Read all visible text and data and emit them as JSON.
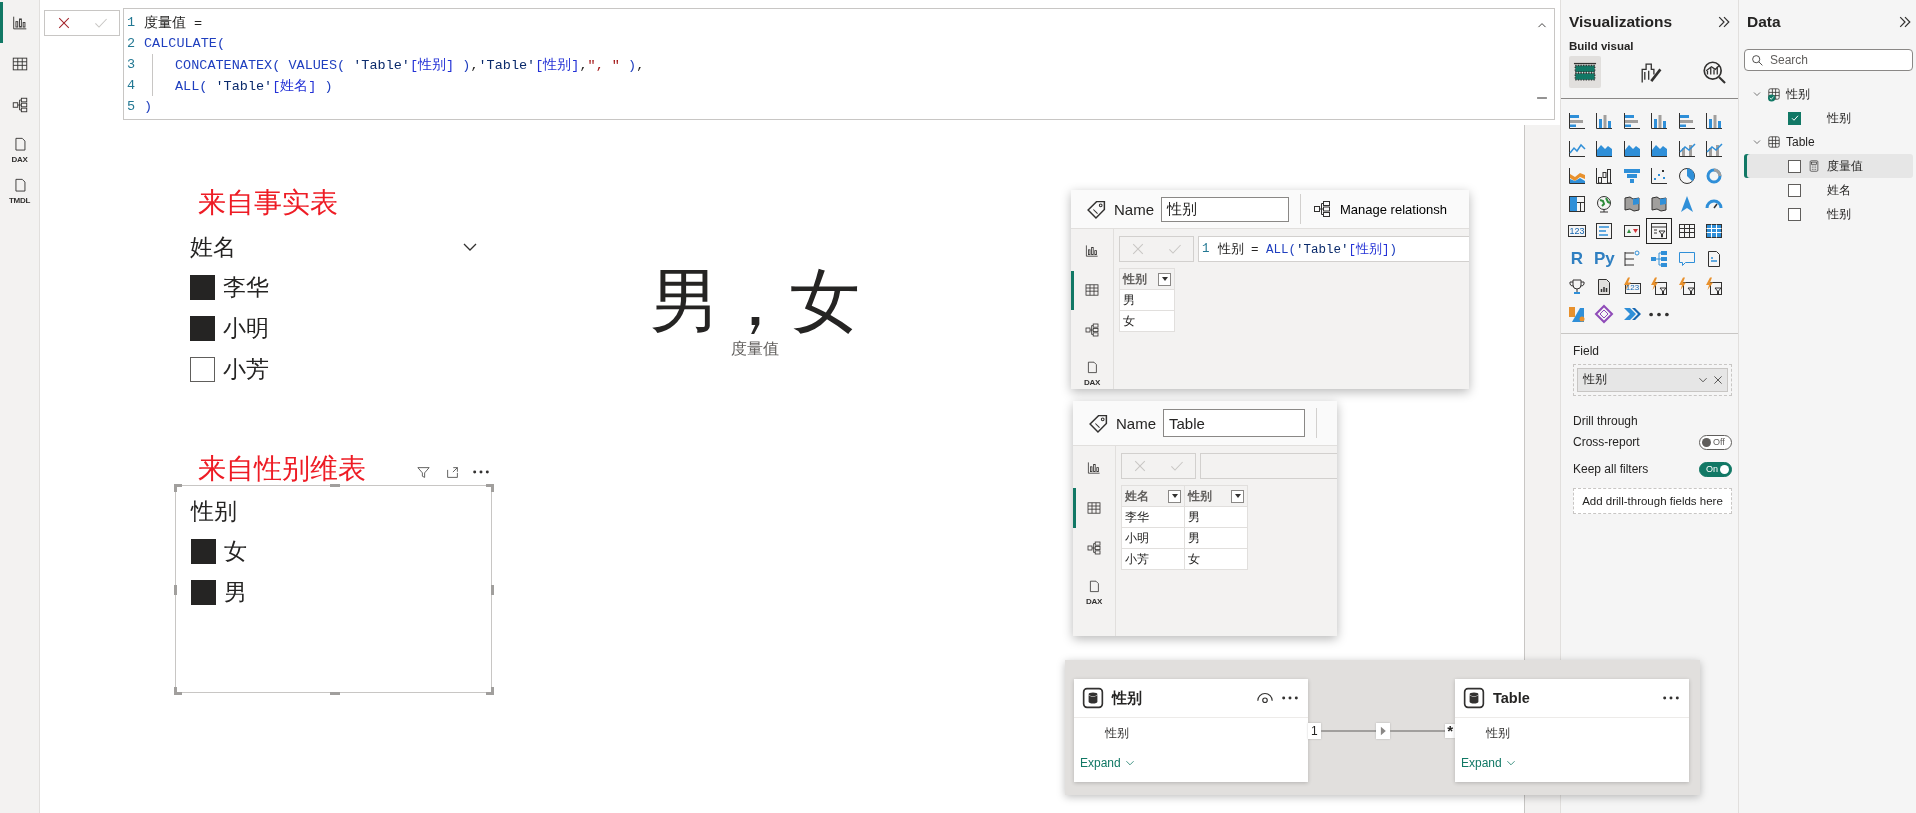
{
  "nav": [
    {
      "kind": "report",
      "selected": true
    },
    {
      "kind": "table",
      "selected": false
    },
    {
      "kind": "model",
      "selected": false
    },
    {
      "kind": "dax",
      "label": "DAX",
      "selected": false
    },
    {
      "kind": "tmdl",
      "label": "TMDL",
      "selected": false
    }
  ],
  "formula_bar": {
    "lines": [
      {
        "number": "1",
        "guide": false,
        "code": "度量值 ="
      },
      {
        "number": "2",
        "guide": false,
        "code": "CALCULATE("
      },
      {
        "number": "3",
        "guide": true,
        "code": "CONCATENATEX( VALUES( 'Table'[性别] ),'Table'[性别],\", \" ),"
      },
      {
        "number": "4",
        "guide": true,
        "code": "ALL( 'Table'[姓名] )"
      },
      {
        "number": "5",
        "guide": false,
        "code": ")"
      }
    ]
  },
  "report": {
    "slicers": [
      {
        "caption": "来自事实表",
        "title": "姓名",
        "dropdown": true,
        "focused": false,
        "items": [
          {
            "label": "李华",
            "checked": true
          },
          {
            "label": "小明",
            "checked": true
          },
          {
            "label": "小芳",
            "checked": false
          }
        ]
      },
      {
        "caption": "来自性别维表",
        "title": "性别",
        "dropdown": false,
        "focused": true,
        "items": [
          {
            "label": "女",
            "checked": true
          },
          {
            "label": "男",
            "checked": true
          }
        ]
      }
    ],
    "card": {
      "value": "男，女",
      "label": "度量值"
    },
    "table_snapshots": [
      {
        "name_label": "Name",
        "name_value": "性别",
        "action": "Manage relationsh",
        "rail": [
          {
            "kind": "report",
            "selected": false
          },
          {
            "kind": "table",
            "selected": true
          },
          {
            "kind": "model",
            "selected": false
          },
          {
            "kind": "dax",
            "label": "DAX",
            "selected": false
          }
        ],
        "formula": {
          "number": "1",
          "code": "性别 = ALL('Table'[性别])"
        },
        "columns": [
          "性别"
        ],
        "rows": [
          [
            "男"
          ],
          [
            "女"
          ]
        ]
      },
      {
        "name_label": "Name",
        "name_value": "Table",
        "rail": [
          {
            "kind": "report",
            "selected": false
          },
          {
            "kind": "table",
            "selected": true
          },
          {
            "kind": "model",
            "selected": false
          },
          {
            "kind": "dax",
            "label": "DAX",
            "selected": false
          }
        ],
        "columns": [
          "姓名",
          "性别"
        ],
        "rows": [
          [
            "李华",
            "男"
          ],
          [
            "小明",
            "男"
          ],
          [
            "小芳",
            "女"
          ]
        ]
      }
    ],
    "model_snapshot": {
      "tables": [
        {
          "name": "性别",
          "eye": true,
          "fields": [
            "性别"
          ],
          "expand": "Expand"
        },
        {
          "name": "Table",
          "eye": false,
          "fields": [
            "性别"
          ],
          "expand": "Expand"
        }
      ],
      "relationship": {
        "from": "1",
        "to": "*"
      }
    }
  },
  "visualizations": {
    "title": "Visualizations",
    "build_label": "Build visual",
    "modes": [
      {
        "selected": true
      },
      {
        "selected": false
      },
      {
        "selected": false
      }
    ],
    "gallery": [
      {
        "selected": false
      },
      {
        "selected": false
      },
      {
        "selected": false
      },
      {
        "selected": false
      },
      {
        "selected": false
      },
      {
        "selected": false
      },
      {
        "selected": false
      },
      {
        "selected": false
      },
      {
        "selected": false
      },
      {
        "selected": false
      },
      {
        "selected": false
      },
      {
        "selected": false
      },
      {
        "selected": false
      },
      {
        "selected": false
      },
      {
        "selected": false
      },
      {
        "selected": false
      },
      {
        "selected": false
      },
      {
        "selected": false
      },
      {
        "selected": false
      },
      {
        "selected": false
      },
      {
        "selected": false
      },
      {
        "selected": false
      },
      {
        "selected": false
      },
      {
        "selected": false
      },
      {
        "selected": false,
        "label": "123"
      },
      {
        "selected": false
      },
      {
        "selected": false
      },
      {
        "selected": true
      },
      {
        "selected": false
      },
      {
        "selected": false
      },
      {
        "selected": false,
        "label": "R"
      },
      {
        "selected": false,
        "label": "Py"
      },
      {
        "selected": false
      },
      {
        "selected": false
      },
      {
        "selected": false
      },
      {
        "selected": false
      },
      {
        "selected": false
      },
      {
        "selected": false
      },
      {
        "selected": false,
        "label": "123"
      },
      {
        "selected": false
      },
      {
        "selected": false
      },
      {
        "selected": false
      },
      {
        "selected": false
      },
      {
        "selected": false
      },
      {
        "selected": false
      },
      {
        "selected": false
      }
    ],
    "field_well": {
      "title": "Field",
      "value": "性别"
    },
    "drill_through": {
      "title": "Drill through",
      "toggles": [
        {
          "label": "Cross-report",
          "on": false,
          "state_text": "Off"
        },
        {
          "label": "Keep all filters",
          "on": true,
          "state_text": "On"
        }
      ],
      "drop_hint": "Add drill-through fields here"
    }
  },
  "data": {
    "title": "Data",
    "search": {
      "placeholder": "Search"
    },
    "tables": [
      {
        "name": "性别",
        "expanded": true,
        "calculated": true,
        "fields": [
          {
            "name": "性别",
            "kind": "column",
            "checked": true,
            "selected": false
          }
        ]
      },
      {
        "name": "Table",
        "expanded": true,
        "calculated": false,
        "fields": [
          {
            "name": "度量值",
            "kind": "measure",
            "checked": false,
            "selected": true
          },
          {
            "name": "姓名",
            "kind": "column",
            "checked": false,
            "selected": false
          },
          {
            "name": "性别",
            "kind": "column",
            "checked": false,
            "selected": false
          }
        ]
      }
    ]
  }
}
